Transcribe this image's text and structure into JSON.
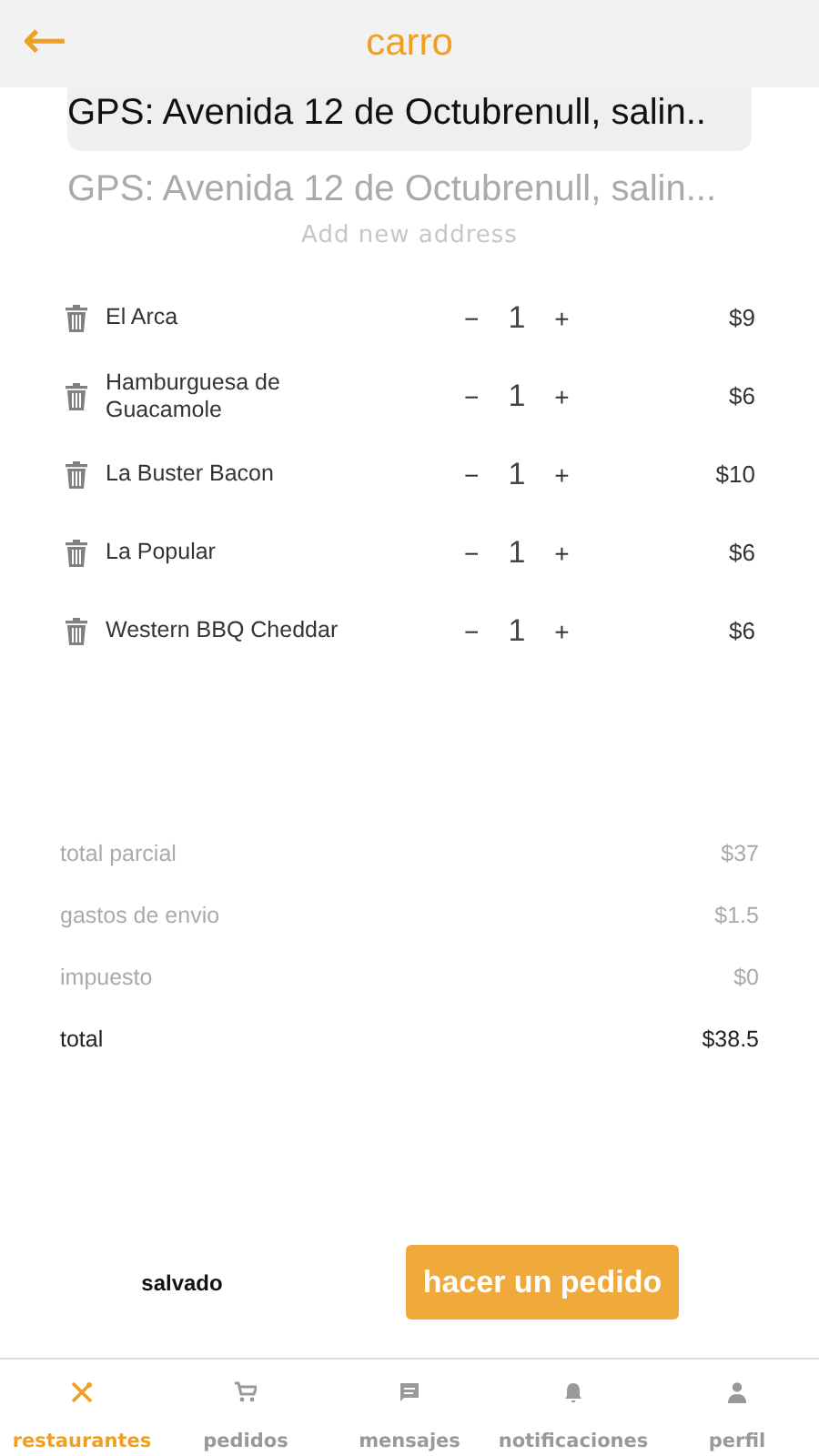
{
  "header": {
    "title": "carro",
    "back": "←"
  },
  "address": {
    "selected": "GPS: Avenida 12 de Octubrenull, salin..",
    "option": "GPS: Avenida 12 de Octubrenull, salin...",
    "add": "Add new address"
  },
  "items": [
    {
      "name": "El Arca",
      "minus": "−",
      "qty": "1",
      "plus": "+",
      "price": "$9"
    },
    {
      "name": "Hamburguesa de Guacamole",
      "minus": "−",
      "qty": "1",
      "plus": "+",
      "price": "$6"
    },
    {
      "name": "La Buster Bacon",
      "minus": "−",
      "qty": "1",
      "plus": "+",
      "price": "$10"
    },
    {
      "name": "La Popular",
      "minus": "−",
      "qty": "1",
      "plus": "+",
      "price": "$6"
    },
    {
      "name": "Western BBQ Cheddar",
      "minus": "−",
      "qty": "1",
      "plus": "+",
      "price": "$6"
    }
  ],
  "totals": [
    {
      "label": "total parcial",
      "value": "$37",
      "kind": "sub"
    },
    {
      "label": "gastos de envio",
      "value": "$1.5",
      "kind": "sub"
    },
    {
      "label": "impuesto",
      "value": "$0",
      "kind": "sub"
    },
    {
      "label": "total",
      "value": "$38.5",
      "kind": "grand"
    }
  ],
  "actions": {
    "save": "salvado",
    "order": "hacer un pedido"
  },
  "tabs": [
    {
      "label": "restaurantes",
      "kind": "restaurants",
      "selected": true
    },
    {
      "label": "pedidos",
      "kind": "orders",
      "selected": false
    },
    {
      "label": "mensajes",
      "kind": "messages",
      "selected": false
    },
    {
      "label": "notificaciones",
      "kind": "notifications",
      "selected": false
    },
    {
      "label": "perfil",
      "kind": "profile",
      "selected": false
    }
  ]
}
